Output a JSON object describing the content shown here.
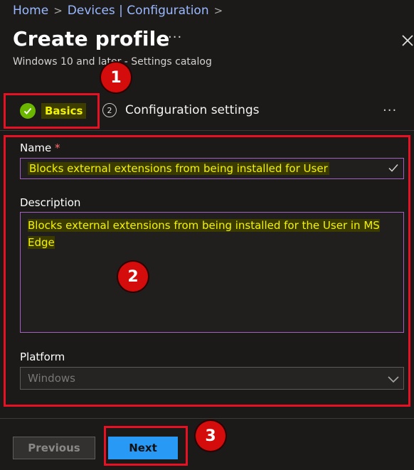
{
  "breadcrumb": {
    "home": "Home",
    "devices": "Devices | Configuration",
    "separator": ">"
  },
  "header": {
    "title": "Create profile",
    "more": "···",
    "subtitle": "Windows 10 and later - Settings catalog"
  },
  "steps": {
    "basics": "Basics",
    "step2_number": "2",
    "config_settings": "Configuration settings",
    "more": "···"
  },
  "form": {
    "name_label": "Name",
    "required_marker": "*",
    "name_value": "Blocks external extensions from being installed  for User",
    "description_label": "Description",
    "description_value": "Blocks external extensions from being installed  for the User in MS Edge",
    "platform_label": "Platform",
    "platform_value": "Windows"
  },
  "footer": {
    "previous": "Previous",
    "next": "Next"
  },
  "annotations": {
    "badge1": "1",
    "badge2": "2",
    "badge3": "3"
  },
  "colors": {
    "background": "#1b1a19",
    "link": "#9ab8ff",
    "check_green": "#6bb700",
    "primary_button": "#2899f5",
    "annotation_red": "#e81123",
    "field_border": "#a260c0",
    "highlight_yellow": "#f4f400"
  },
  "icons": [
    "chevron-right-icon",
    "close-icon",
    "check-circle-icon",
    "checkmark-icon",
    "chevron-down-icon"
  ]
}
